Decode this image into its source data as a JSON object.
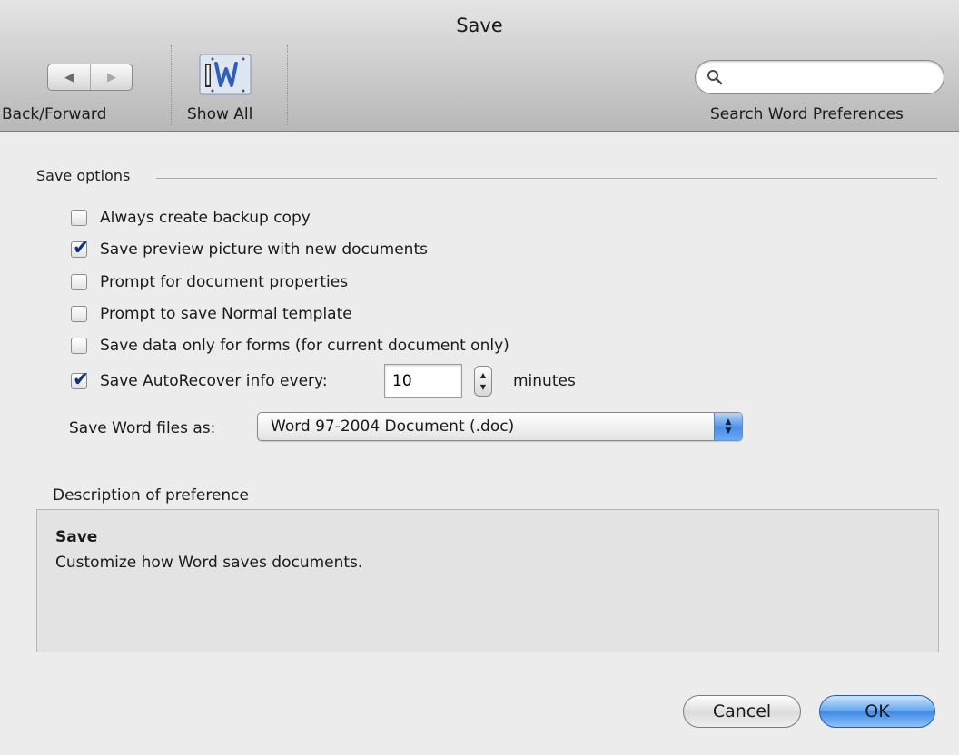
{
  "window": {
    "title": "Save"
  },
  "toolbar": {
    "back_forward_label": "Back/Forward",
    "back_glyph": "◀",
    "forward_glyph": "▶",
    "show_all_label": "Show All",
    "search_label": "Search Word Preferences",
    "search_value": "",
    "search_icon": "magnifier-icon",
    "show_all_icon": "word-show-all-icon"
  },
  "save_options": {
    "group_title": "Save options",
    "items": [
      {
        "label": "Always create backup copy",
        "checked": false
      },
      {
        "label": "Save preview picture with new documents",
        "checked": true
      },
      {
        "label": "Prompt for document properties",
        "checked": false
      },
      {
        "label": "Prompt to save Normal template",
        "checked": false
      },
      {
        "label": "Save data only for forms (for current document only)",
        "checked": false
      },
      {
        "label": "Save AutoRecover info every:",
        "checked": true
      }
    ],
    "autorecover_minutes": "10",
    "minutes_label": "minutes",
    "save_as_label": "Save Word files as:",
    "save_as_value": "Word 97-2004 Document (.doc)"
  },
  "description": {
    "section_label": "Description of preference",
    "title": "Save",
    "text": "Customize how Word saves documents."
  },
  "buttons": {
    "cancel": "Cancel",
    "ok": "OK"
  },
  "colors": {
    "accent": "#4a8ee6",
    "checkmark": "#0f2f84",
    "toolbar_bottom": "#b8b8b8"
  }
}
